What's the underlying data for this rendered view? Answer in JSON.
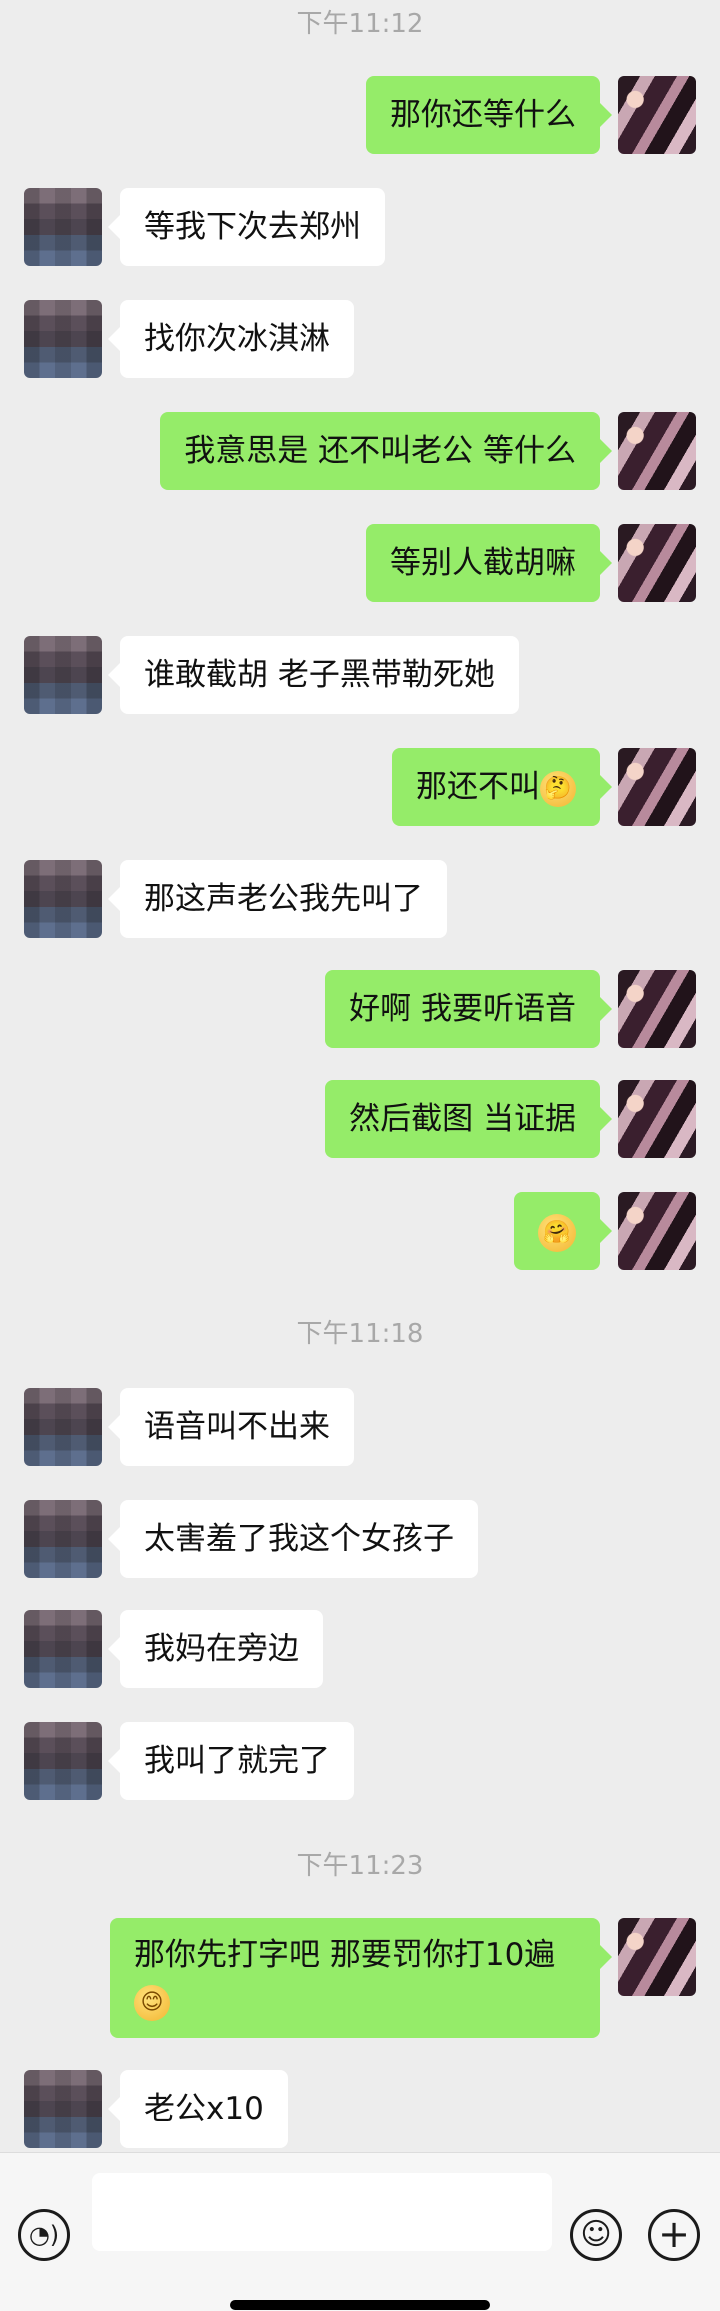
{
  "timestamps": [
    "下午11:12",
    "下午11:18",
    "下午11:23"
  ],
  "messages": [
    {
      "side": "out",
      "text": "那你还等什么"
    },
    {
      "side": "in",
      "text": "等我下次去郑州"
    },
    {
      "side": "in",
      "text": "找你次冰淇淋"
    },
    {
      "side": "out",
      "text": "我意思是 还不叫老公 等什么"
    },
    {
      "side": "out",
      "text": "等别人截胡嘛"
    },
    {
      "side": "in",
      "text": "谁敢截胡 老子黑带勒死她"
    },
    {
      "side": "out",
      "text": "那还不叫",
      "emoji": "thinking-face-emoji",
      "emoji_glyph": "🤔"
    },
    {
      "side": "in",
      "text": "那这声老公我先叫了"
    },
    {
      "side": "out",
      "text": "好啊 我要听语音"
    },
    {
      "side": "out",
      "text": "然后截图 当证据"
    },
    {
      "side": "out",
      "text": "",
      "emoji": "hugging-face-emoji",
      "emoji_glyph": "🤗"
    },
    {
      "side": "in",
      "text": "语音叫不出来"
    },
    {
      "side": "in",
      "text": "太害羞了我这个女孩子"
    },
    {
      "side": "in",
      "text": "我妈在旁边"
    },
    {
      "side": "in",
      "text": "我叫了就完了"
    },
    {
      "side": "out",
      "text": "那你先打字吧 那要罚你打10遍",
      "emoji": "smiling-face-emoji",
      "emoji_glyph": "😊"
    },
    {
      "side": "in",
      "text": "老公x10"
    }
  ],
  "input_bar": {
    "voice_icon": "voice-icon",
    "voice_glyph": "◔)",
    "emoji_icon": "smile-icon",
    "emoji_glyph": "☺",
    "plus_icon": "plus-icon",
    "plus_glyph": "+",
    "value": ""
  },
  "colors": {
    "background": "#ededed",
    "outgoing_bubble": "#95ec69",
    "incoming_bubble": "#ffffff",
    "timestamp": "#a8a8a8"
  }
}
